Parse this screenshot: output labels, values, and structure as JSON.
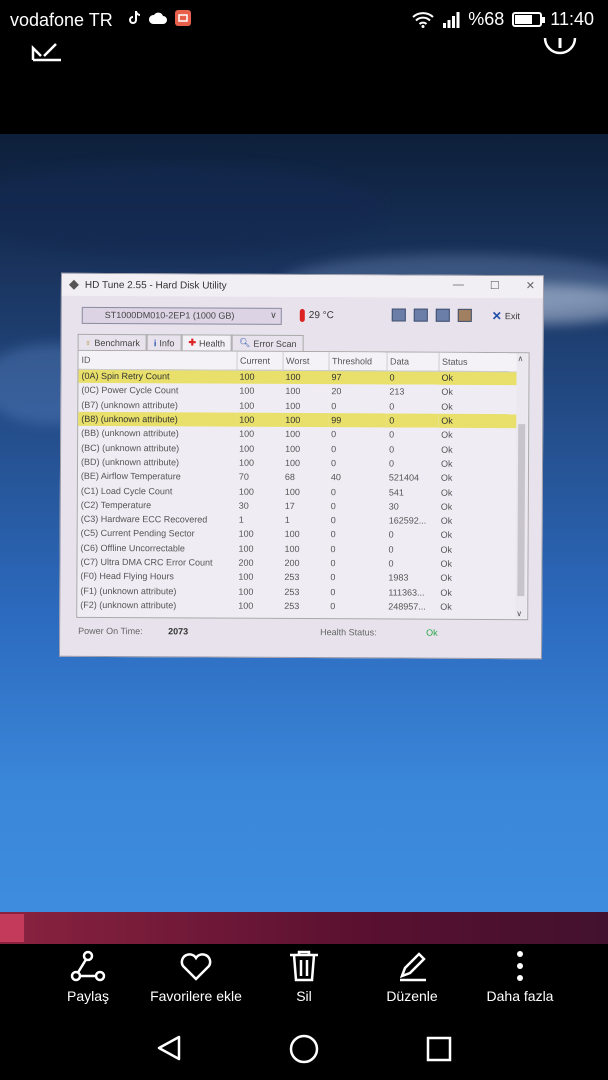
{
  "status_bar": {
    "carrier": "vodafone TR",
    "battery_percent": "%68",
    "battery_level": 0.68,
    "time": "11:40"
  },
  "hdtune": {
    "title": "HD Tune 2.55 - Hard Disk Utility",
    "drive": "ST1000DM010-2EP1 (1000 GB)",
    "temperature": "29 °C",
    "exit_label": "Exit",
    "tabs": [
      {
        "label": "Benchmark",
        "icon": "benchmark-icon"
      },
      {
        "label": "Info",
        "icon": "info-icon"
      },
      {
        "label": "Health",
        "icon": "health-icon"
      },
      {
        "label": "Error Scan",
        "icon": "error-scan-icon"
      }
    ],
    "columns": [
      "ID",
      "Current",
      "Worst",
      "Threshold",
      "Data",
      "Status"
    ],
    "rows": [
      {
        "id": "(0A) Spin Retry Count",
        "current": "100",
        "worst": "100",
        "threshold": "97",
        "data": "0",
        "status": "Ok",
        "highlight": true
      },
      {
        "id": "(0C) Power Cycle Count",
        "current": "100",
        "worst": "100",
        "threshold": "20",
        "data": "213",
        "status": "Ok",
        "highlight": false
      },
      {
        "id": "(B7) (unknown attribute)",
        "current": "100",
        "worst": "100",
        "threshold": "0",
        "data": "0",
        "status": "Ok",
        "highlight": false
      },
      {
        "id": "(B8) (unknown attribute)",
        "current": "100",
        "worst": "100",
        "threshold": "99",
        "data": "0",
        "status": "Ok",
        "highlight": true
      },
      {
        "id": "(BB) (unknown attribute)",
        "current": "100",
        "worst": "100",
        "threshold": "0",
        "data": "0",
        "status": "Ok",
        "highlight": false
      },
      {
        "id": "(BC) (unknown attribute)",
        "current": "100",
        "worst": "100",
        "threshold": "0",
        "data": "0",
        "status": "Ok",
        "highlight": false
      },
      {
        "id": "(BD) (unknown attribute)",
        "current": "100",
        "worst": "100",
        "threshold": "0",
        "data": "0",
        "status": "Ok",
        "highlight": false
      },
      {
        "id": "(BE) Airflow Temperature",
        "current": "70",
        "worst": "68",
        "threshold": "40",
        "data": "521404",
        "status": "Ok",
        "highlight": false
      },
      {
        "id": "(C1) Load Cycle Count",
        "current": "100",
        "worst": "100",
        "threshold": "0",
        "data": "541",
        "status": "Ok",
        "highlight": false
      },
      {
        "id": "(C2) Temperature",
        "current": "30",
        "worst": "17",
        "threshold": "0",
        "data": "30",
        "status": "Ok",
        "highlight": false
      },
      {
        "id": "(C3) Hardware ECC Recovered",
        "current": "1",
        "worst": "1",
        "threshold": "0",
        "data": "162592...",
        "status": "Ok",
        "highlight": false
      },
      {
        "id": "(C5) Current Pending Sector",
        "current": "100",
        "worst": "100",
        "threshold": "0",
        "data": "0",
        "status": "Ok",
        "highlight": false
      },
      {
        "id": "(C6) Offline Uncorrectable",
        "current": "100",
        "worst": "100",
        "threshold": "0",
        "data": "0",
        "status": "Ok",
        "highlight": false
      },
      {
        "id": "(C7) Ultra DMA CRC Error Count",
        "current": "200",
        "worst": "200",
        "threshold": "0",
        "data": "0",
        "status": "Ok",
        "highlight": false
      },
      {
        "id": "(F0) Head Flying Hours",
        "current": "100",
        "worst": "253",
        "threshold": "0",
        "data": "1983",
        "status": "Ok",
        "highlight": false
      },
      {
        "id": "(F1) (unknown attribute)",
        "current": "100",
        "worst": "253",
        "threshold": "0",
        "data": "111363...",
        "status": "Ok",
        "highlight": false
      },
      {
        "id": "(F2) (unknown attribute)",
        "current": "100",
        "worst": "253",
        "threshold": "0",
        "data": "248957...",
        "status": "Ok",
        "highlight": false
      }
    ],
    "power_on_label": "Power On Time:",
    "power_on_value": "2073",
    "health_label": "Health Status:",
    "health_value": "Ok"
  },
  "actions": [
    {
      "label": "Paylaş",
      "icon": "share-icon"
    },
    {
      "label": "Favorilere ekle",
      "icon": "heart-icon"
    },
    {
      "label": "Sil",
      "icon": "trash-icon"
    },
    {
      "label": "Düzenle",
      "icon": "pencil-icon"
    },
    {
      "label": "Daha fazla",
      "icon": "more-icon"
    }
  ],
  "colors": {
    "highlight": "#e8e06a",
    "health_ok": "#2aa84a"
  }
}
